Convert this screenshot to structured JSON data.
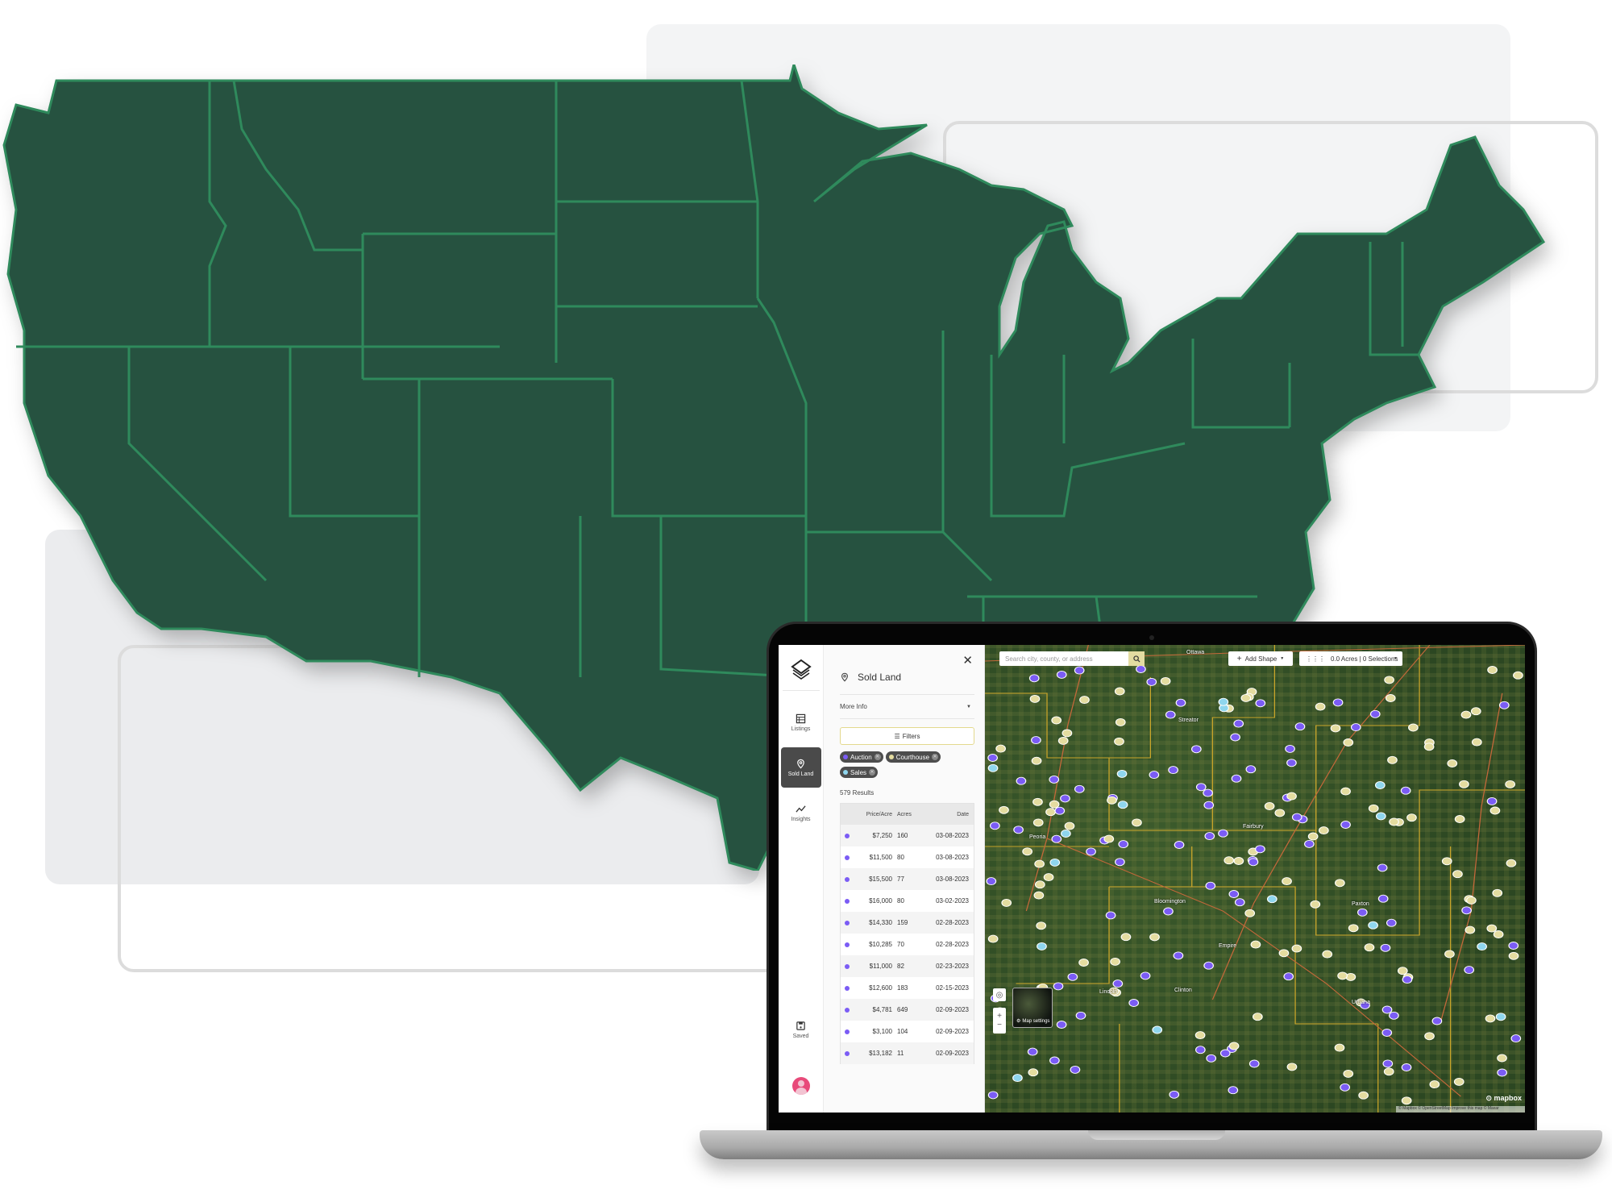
{
  "app": {
    "rail": {
      "logo_icon": "layers-icon",
      "items": [
        {
          "label": "Listings",
          "icon": "table-icon",
          "active": false
        },
        {
          "label": "Sold Land",
          "icon": "map-pin-icon",
          "active": true
        },
        {
          "label": "Insights",
          "icon": "sparkline-icon",
          "active": false
        }
      ],
      "saved_label": "Saved",
      "avatar_color": "#e84a7a"
    },
    "panel": {
      "title": "Sold Land",
      "close_icon": "close-icon",
      "more_info_label": "More Info",
      "filters_label": "Filters",
      "chips": [
        {
          "label": "Auction",
          "color": "#7b5cf5"
        },
        {
          "label": "Courthouse",
          "color": "#e4dca0"
        },
        {
          "label": "Sales",
          "color": "#8fd6ee"
        }
      ],
      "results_label": "579 Results",
      "table": {
        "headers": [
          "",
          "Price/Acre",
          "Acres",
          "Date"
        ],
        "rows": [
          {
            "price": "$7,250",
            "acres": "160",
            "date": "03-08-2023",
            "type": "Auction"
          },
          {
            "price": "$11,500",
            "acres": "80",
            "date": "03-08-2023",
            "type": "Auction"
          },
          {
            "price": "$15,500",
            "acres": "77",
            "date": "03-08-2023",
            "type": "Auction"
          },
          {
            "price": "$16,000",
            "acres": "80",
            "date": "03-02-2023",
            "type": "Auction"
          },
          {
            "price": "$14,330",
            "acres": "159",
            "date": "02-28-2023",
            "type": "Auction"
          },
          {
            "price": "$10,285",
            "acres": "70",
            "date": "02-28-2023",
            "type": "Auction"
          },
          {
            "price": "$11,000",
            "acres": "82",
            "date": "02-23-2023",
            "type": "Auction"
          },
          {
            "price": "$12,600",
            "acres": "183",
            "date": "02-15-2023",
            "type": "Auction"
          },
          {
            "price": "$4,781",
            "acres": "649",
            "date": "02-09-2023",
            "type": "Auction"
          },
          {
            "price": "$3,100",
            "acres": "104",
            "date": "02-09-2023",
            "type": "Auction"
          },
          {
            "price": "$13,182",
            "acres": "11",
            "date": "02-09-2023",
            "type": "Auction"
          }
        ]
      }
    },
    "map": {
      "search_placeholder": "Search city, county, or address",
      "add_shape_label": "Add Shape",
      "selections_label": "0.0 Acres | 0 Selections",
      "map_settings_label": "Map settings",
      "mapbox_label": "mapbox",
      "attribution": "© Mapbox © OpenStreetMap Improve this map © Maxar",
      "places": [
        "Ottawa",
        "Streator",
        "Peoria",
        "Fairbury",
        "Bloomington",
        "Lincoln",
        "Clinton",
        "Empire",
        "Paxton",
        "Urbana"
      ],
      "marker_colors": {
        "auction": "#7b5cf5",
        "courthouse": "#e4dca0",
        "sales": "#8fd6ee"
      }
    }
  },
  "colors": {
    "state_fill": "#265240",
    "state_border": "#2f8a5c"
  }
}
